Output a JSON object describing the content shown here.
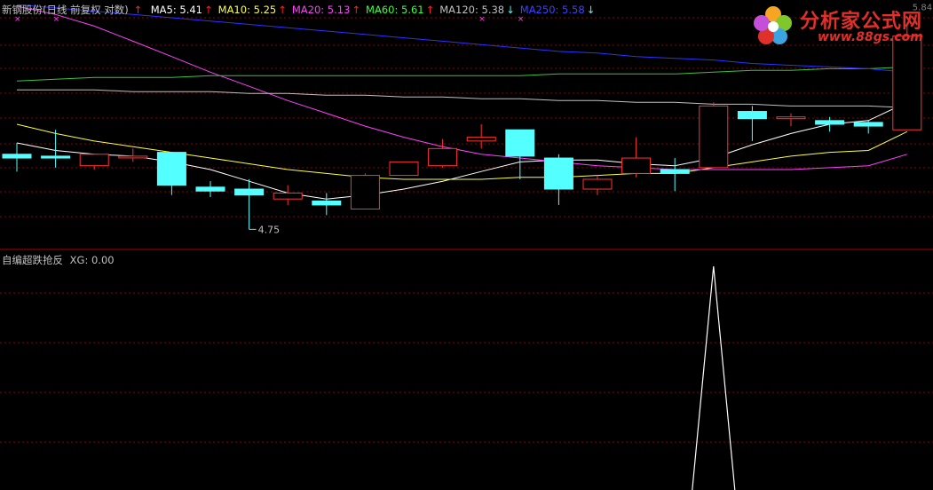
{
  "header": {
    "title": "新钢股份(日线 前复权 对数)",
    "ma_items": [
      {
        "label": "MA5: 5.41",
        "arrow": "↑",
        "color": "#ffffff",
        "arrow_color": "#ff2020"
      },
      {
        "label": "MA10: 5.25",
        "arrow": "↑",
        "color": "#ffff40",
        "arrow_color": "#ff2020"
      },
      {
        "label": "MA20: 5.13",
        "arrow": "↑",
        "color": "#ff40ff",
        "arrow_color": "#ff2020"
      },
      {
        "label": "MA60: 5.61",
        "arrow": "↑",
        "color": "#40ff40",
        "arrow_color": "#ff2020"
      },
      {
        "label": "MA120: 5.38",
        "arrow": "↓",
        "color": "#c0c0c0",
        "arrow_color": "#40ffff"
      },
      {
        "label": "MA250: 5.58",
        "arrow": "↓",
        "color": "#4040ff",
        "arrow_color": "#40ffff"
      }
    ],
    "lead_arrow": "↑",
    "lead_arrow_color": "#ff2020"
  },
  "indicator": {
    "title": "自编超跌抢反",
    "value_label": "XG: 0.00"
  },
  "logo": {
    "text": "分析家公式网",
    "url_text": "www.88gs.com"
  },
  "annotations": {
    "low_label": "4.75",
    "high_label": "5.84"
  },
  "colors": {
    "up": "#ff3333",
    "down": "#54ffff",
    "grid": "#8b0000",
    "ma5": "#ffffff",
    "ma10": "#ffff40",
    "ma20": "#ff40ff",
    "ma60": "#40c040",
    "ma120": "#c0c0c0",
    "ma250": "#3030ff",
    "xg": "#ffffff"
  },
  "chart_data": [
    {
      "type": "candlestick",
      "title": "新钢股份(日线 前复权 对数)",
      "log_scale": true,
      "ylim": [
        4.7,
        5.9
      ],
      "candles": [
        {
          "o": 5.13,
          "h": 5.19,
          "l": 5.04,
          "c": 5.11
        },
        {
          "o": 5.12,
          "h": 5.26,
          "l": 5.06,
          "c": 5.11
        },
        {
          "o": 5.07,
          "h": 5.13,
          "l": 5.05,
          "c": 5.13
        },
        {
          "o": 5.12,
          "h": 5.16,
          "l": 5.09,
          "c": 5.12
        },
        {
          "o": 5.14,
          "h": 5.14,
          "l": 4.92,
          "c": 4.97
        },
        {
          "o": 4.96,
          "h": 4.99,
          "l": 4.91,
          "c": 4.94
        },
        {
          "o": 4.95,
          "h": 5.0,
          "l": 4.75,
          "c": 4.92
        },
        {
          "o": 4.9,
          "h": 4.97,
          "l": 4.87,
          "c": 4.93
        },
        {
          "o": 4.89,
          "h": 4.93,
          "l": 4.82,
          "c": 4.87
        },
        {
          "o": 4.85,
          "h": 5.03,
          "l": 4.85,
          "c": 5.02
        },
        {
          "o": 5.02,
          "h": 5.09,
          "l": 5.02,
          "c": 5.09
        },
        {
          "o": 5.07,
          "h": 5.21,
          "l": 5.06,
          "c": 5.16
        },
        {
          "o": 5.2,
          "h": 5.29,
          "l": 5.16,
          "c": 5.22
        },
        {
          "o": 5.26,
          "h": 5.26,
          "l": 5.0,
          "c": 5.12
        },
        {
          "o": 5.11,
          "h": 5.13,
          "l": 4.87,
          "c": 4.95
        },
        {
          "o": 4.95,
          "h": 5.02,
          "l": 4.92,
          "c": 5.0
        },
        {
          "o": 5.03,
          "h": 5.22,
          "l": 5.01,
          "c": 5.11
        },
        {
          "o": 5.05,
          "h": 5.11,
          "l": 4.94,
          "c": 5.03
        },
        {
          "o": 5.06,
          "h": 5.41,
          "l": 5.06,
          "c": 5.39
        },
        {
          "o": 5.36,
          "h": 5.39,
          "l": 5.2,
          "c": 5.32
        },
        {
          "o": 5.33,
          "h": 5.35,
          "l": 5.28,
          "c": 5.33
        },
        {
          "o": 5.31,
          "h": 5.33,
          "l": 5.25,
          "c": 5.29
        },
        {
          "o": 5.3,
          "h": 5.31,
          "l": 5.24,
          "c": 5.28
        },
        {
          "o": 5.26,
          "h": 5.87,
          "l": 5.26,
          "c": 5.79
        }
      ],
      "series": [
        {
          "name": "MA5",
          "values": [
            5.19,
            5.15,
            5.13,
            5.12,
            5.09,
            5.05,
            4.99,
            4.93,
            4.9,
            4.92,
            4.95,
            4.99,
            5.04,
            5.09,
            5.1,
            5.1,
            5.08,
            5.07,
            5.11,
            5.18,
            5.24,
            5.29,
            5.31,
            5.41
          ]
        },
        {
          "name": "MA10",
          "values": [
            5.29,
            5.24,
            5.2,
            5.17,
            5.14,
            5.11,
            5.08,
            5.05,
            5.03,
            5.01,
            5.0,
            5.0,
            5.0,
            5.01,
            5.01,
            5.02,
            5.03,
            5.03,
            5.06,
            5.09,
            5.12,
            5.14,
            5.15,
            5.25
          ]
        },
        {
          "name": "MA20",
          "values": [
            5.97,
            5.92,
            5.85,
            5.76,
            5.67,
            5.58,
            5.5,
            5.42,
            5.35,
            5.28,
            5.22,
            5.17,
            5.13,
            5.11,
            5.09,
            5.07,
            5.06,
            5.05,
            5.05,
            5.05,
            5.05,
            5.06,
            5.07,
            5.13
          ]
        },
        {
          "name": "MA60",
          "values": [
            5.53,
            5.54,
            5.55,
            5.55,
            5.55,
            5.56,
            5.56,
            5.56,
            5.56,
            5.56,
            5.56,
            5.56,
            5.56,
            5.56,
            5.57,
            5.57,
            5.57,
            5.57,
            5.58,
            5.59,
            5.59,
            5.6,
            5.6,
            5.61
          ]
        },
        {
          "name": "MA120",
          "values": [
            5.48,
            5.48,
            5.48,
            5.47,
            5.47,
            5.47,
            5.46,
            5.46,
            5.45,
            5.45,
            5.44,
            5.44,
            5.43,
            5.43,
            5.42,
            5.42,
            5.41,
            5.41,
            5.4,
            5.4,
            5.39,
            5.39,
            5.39,
            5.38
          ]
        },
        {
          "name": "MA250",
          "values": [
            5.98,
            5.96,
            5.94,
            5.92,
            5.9,
            5.88,
            5.86,
            5.84,
            5.82,
            5.8,
            5.78,
            5.76,
            5.74,
            5.72,
            5.7,
            5.69,
            5.67,
            5.66,
            5.65,
            5.63,
            5.62,
            5.61,
            5.6,
            5.58
          ]
        }
      ]
    },
    {
      "type": "line",
      "title": "自编超跌抢反",
      "series": [
        {
          "name": "XG",
          "values": [
            0,
            0,
            0,
            0,
            0,
            0,
            0,
            0,
            0,
            0,
            0,
            0,
            0,
            0,
            0,
            0,
            0,
            0,
            1,
            0,
            0,
            0,
            0,
            0
          ]
        }
      ],
      "ylim": [
        0,
        1
      ]
    }
  ]
}
